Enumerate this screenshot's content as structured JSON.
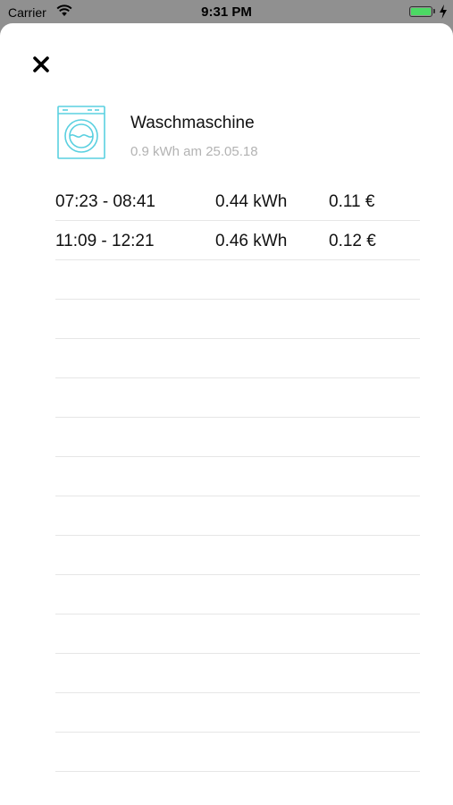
{
  "status_bar": {
    "carrier": "Carrier",
    "time": "9:31 PM",
    "battery_level": 1.0,
    "battery_color": "#4cd964",
    "wifi_icon": "wifi-icon",
    "charging_icon": "bolt-icon"
  },
  "header": {
    "close_icon": "close-icon"
  },
  "device": {
    "icon": "washing-machine-icon",
    "icon_color": "#5ad0e0",
    "name": "Waschmaschine",
    "summary": "0.9 kWh am 25.05.18"
  },
  "sessions": [
    {
      "time": "07:23 - 08:41",
      "energy": "0.44 kWh",
      "cost": "0.11 €"
    },
    {
      "time": "11:09 - 12:21",
      "energy": "0.46 kWh",
      "cost": "0.12 €"
    }
  ]
}
